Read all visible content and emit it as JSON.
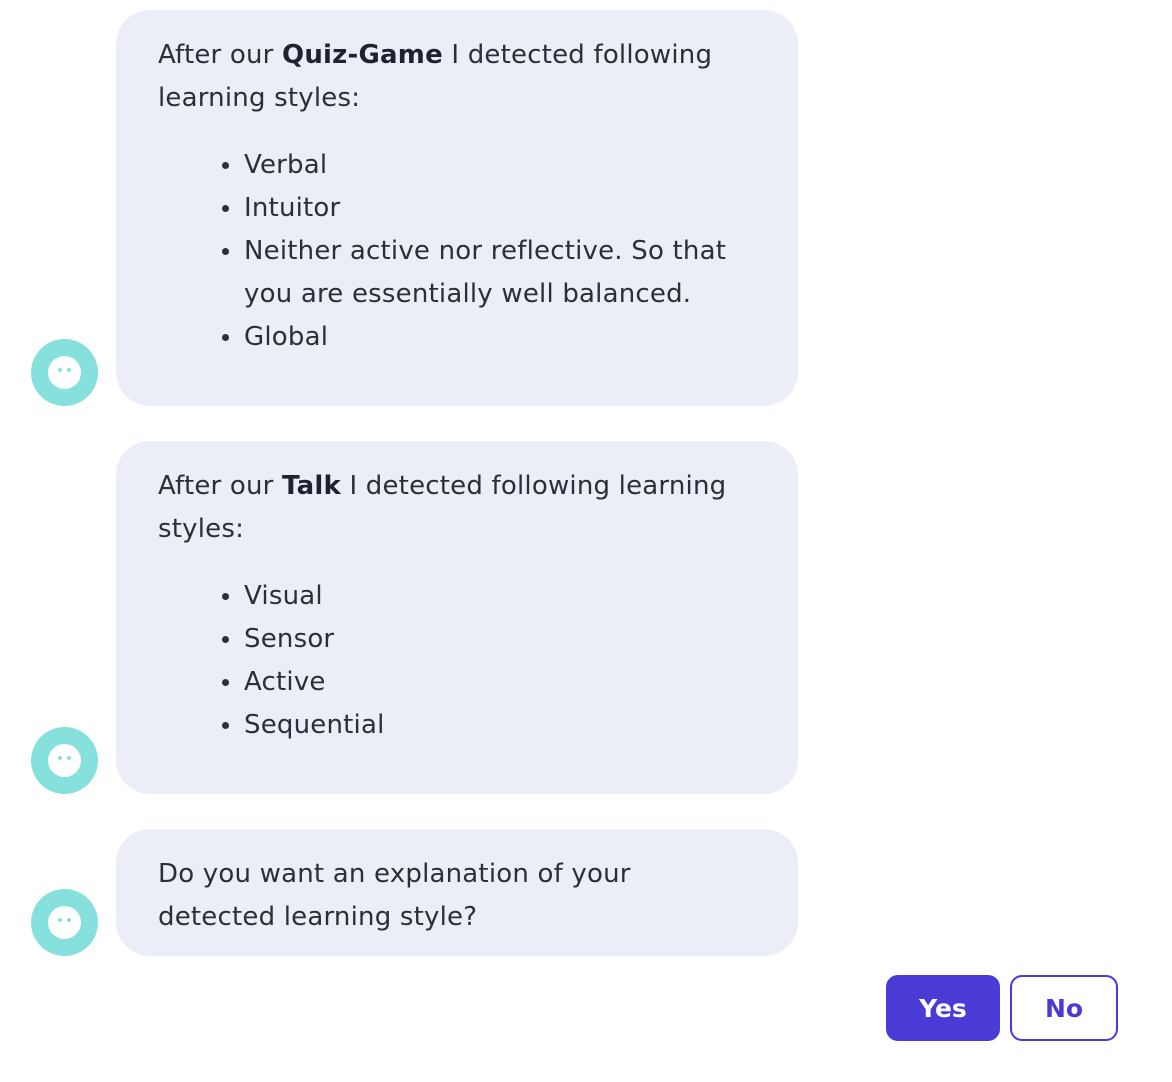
{
  "messages": [
    {
      "intro_before": "After our ",
      "intro_bold": "Quiz-Game",
      "intro_after": " I detected following learning styles:",
      "items": [
        "Verbal",
        "Intuitor",
        "Neither active nor reflective. So that you are essentially well balanced.",
        "Global"
      ]
    },
    {
      "intro_before": "After our ",
      "intro_bold": "Talk",
      "intro_after": " I detected following learning styles:",
      "items": [
        "Visual",
        "Sensor",
        "Active",
        "Sequential"
      ]
    },
    {
      "text": "Do you want an explanation of your detected learning style?"
    }
  ],
  "quick_replies": {
    "yes_label": "Yes",
    "no_label": "No"
  },
  "colors": {
    "bubble_bg": "#ebedf7",
    "avatar": "#86e1dd",
    "accent": "#4a3ad6"
  },
  "icons": {
    "bot_avatar": "bot-avatar-icon"
  }
}
